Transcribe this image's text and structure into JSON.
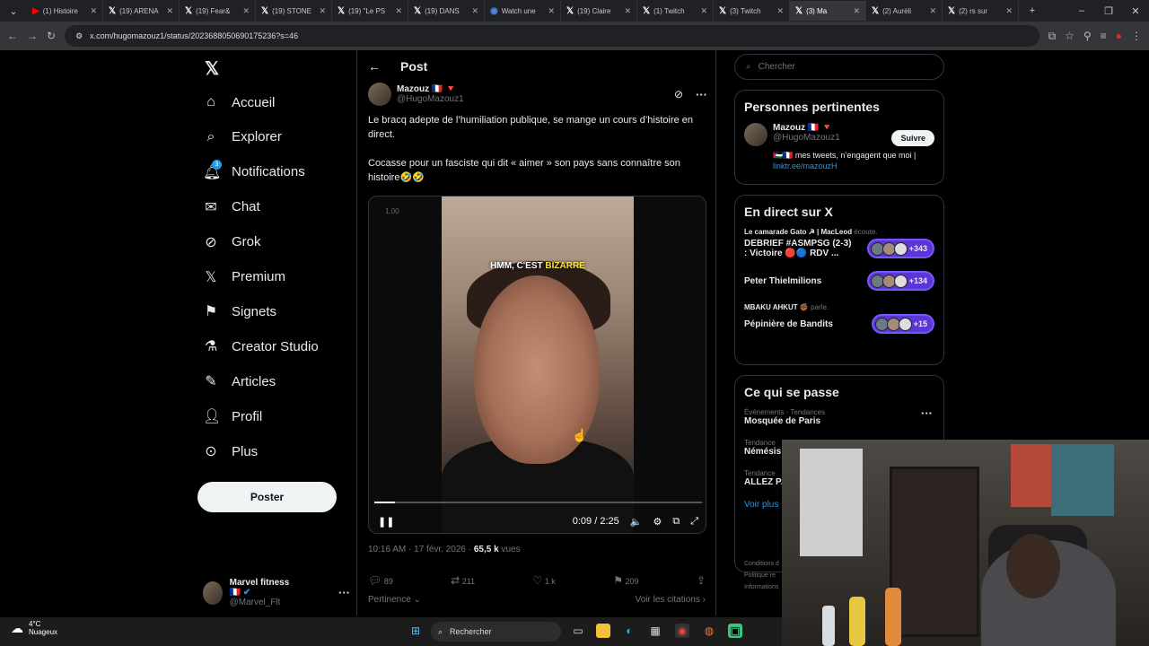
{
  "browser": {
    "tabs": [
      {
        "label": "(1) Histoire",
        "icon": "youtube-icon"
      },
      {
        "label": "(19) ARENA",
        "icon": "x-logo-icon"
      },
      {
        "label": "(19) Fear&",
        "icon": "x-logo-icon"
      },
      {
        "label": "(19) STONE",
        "icon": "x-logo-icon"
      },
      {
        "label": "(19) \"Le PS",
        "icon": "x-logo-icon"
      },
      {
        "label": "(19) DANS",
        "icon": "x-logo-icon"
      },
      {
        "label": "Watch une",
        "icon": "chrome-icon"
      },
      {
        "label": "(19) Claire",
        "icon": "x-logo-icon"
      },
      {
        "label": "(1) Twitch",
        "icon": "x-logo-icon"
      },
      {
        "label": "(3) Twitch",
        "icon": "x-logo-icon"
      },
      {
        "label": "(3) Ma",
        "icon": "x-logo-icon",
        "active": true
      },
      {
        "label": "(2) Auréli",
        "icon": "x-logo-icon"
      },
      {
        "label": "(2) rs sur",
        "icon": "x-logo-icon"
      }
    ],
    "url": "x.com/hugomazouz1/status/2023688050690175236?s=46"
  },
  "nav": {
    "items": [
      {
        "label": "Accueil",
        "icon": "home-icon"
      },
      {
        "label": "Explorer",
        "icon": "search-icon"
      },
      {
        "label": "Notifications",
        "icon": "bell-icon",
        "badge": "3"
      },
      {
        "label": "Chat",
        "icon": "mail-icon"
      },
      {
        "label": "Grok",
        "icon": "grok-icon"
      },
      {
        "label": "Premium",
        "icon": "x-logo-icon"
      },
      {
        "label": "Signets",
        "icon": "bookmark-icon"
      },
      {
        "label": "Creator Studio",
        "icon": "flask-icon"
      },
      {
        "label": "Articles",
        "icon": "article-icon"
      },
      {
        "label": "Profil",
        "icon": "person-icon"
      },
      {
        "label": "Plus",
        "icon": "more-circle-icon"
      }
    ],
    "post_button": "Poster",
    "account": {
      "name": "Marvel fitness",
      "flag": "🇫🇷",
      "handle": "@Marvel_Flt"
    }
  },
  "post": {
    "header": "Post",
    "author": {
      "name": "Mazouz",
      "flags": "🇫🇷 🔻",
      "handle": "@HugoMazouz1"
    },
    "text1": "Le bracq adepte de l’humiliation publique, se mange un cours d’histoire en direct.",
    "text2": "Cocasse pour un fasciste qui dit « aimer » son pays  sans connaître son histoire🤣🤣",
    "video": {
      "caption_pre": "HMM, C'EST ",
      "caption_hl": "BIZARRE",
      "rate": "1.00",
      "time": "0:09 / 2:25",
      "progress": 0.062
    },
    "timestamp": "10:16 AM · 17 févr. 2026 · ",
    "views_count": "65,5 k",
    "views_label": " vues",
    "actions": {
      "replies": "89",
      "reposts": "211",
      "likes": "1 k",
      "bookmarks": "209"
    },
    "sort": "Pertinence",
    "quotes": "Voir les citations"
  },
  "sidebar": {
    "search_placeholder": "Chercher",
    "relevant": {
      "title": "Personnes pertinentes",
      "name": "Mazouz",
      "flags": "🇫🇷 🔻",
      "handle": "@HugoMazouz1",
      "follow": "Suivre",
      "bio_pre": "🇵🇸🇫🇷 mes tweets, n’engagent que moi | ",
      "bio_link": "linktr.ee/mazouzH"
    },
    "live": {
      "title": "En direct sur X",
      "spaces": [
        {
          "host": "Le camarade Gato ☭ | MacLeod",
          "host_suffix": "écoute.",
          "title": "DEBRIEF #ASMPSG (2-3) : Victoire 🔴🔵 RDV ...",
          "count": "+343"
        },
        {
          "host": "",
          "host_suffix": "",
          "title": "Peter Thielmilions",
          "count": "+134"
        },
        {
          "host": "MBAKU AHKUT ✊🏾",
          "host_suffix": "parle.",
          "title": "Pépinière de Bandits",
          "count": "+15"
        }
      ]
    },
    "happening": {
      "title": "Ce qui se passe",
      "trends": [
        {
          "cat": "Événements · Tendances",
          "name": "Mosquée de Paris"
        },
        {
          "cat": "Tendance",
          "name": "Némésis"
        },
        {
          "cat": "Tendance",
          "name": "ALLEZ PA"
        }
      ],
      "more": "Voir plus"
    },
    "footer": [
      "Conditions d",
      "Politique re",
      "Informations"
    ]
  },
  "taskbar": {
    "temp": "4°C",
    "weather": "Nuageux",
    "search": "Rechercher"
  },
  "colors": {
    "accent": "#1d9bf0",
    "space_purple": "#7856ff",
    "caption_yellow": "#f6e33a"
  }
}
